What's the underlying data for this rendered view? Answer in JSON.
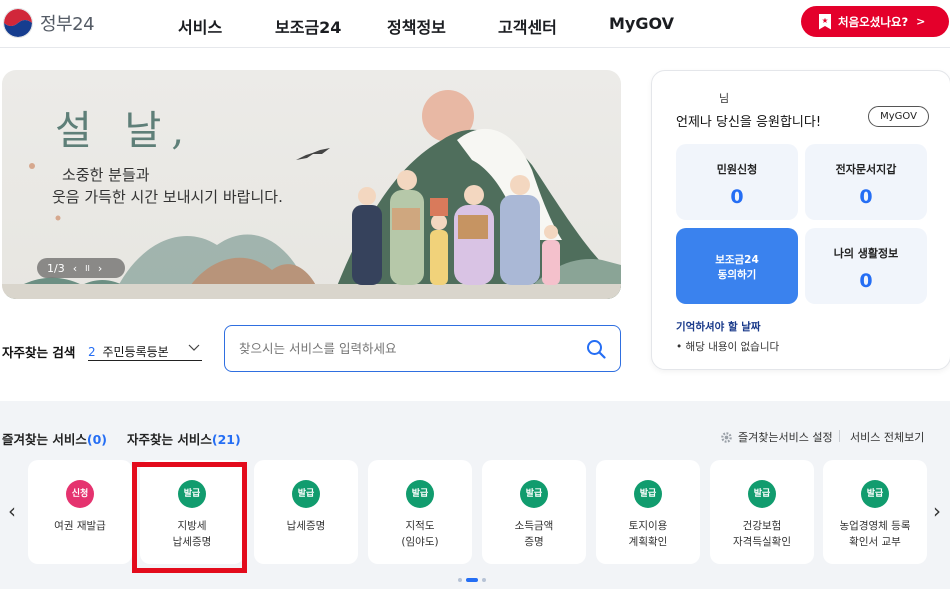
{
  "header": {
    "logo_text": "정부24",
    "nav": [
      "서비스",
      "보조금24",
      "정책정보",
      "고객센터",
      "MyGOV"
    ],
    "first_visit_label": "처음오셨나요?",
    "first_visit_chevron": ">"
  },
  "banner": {
    "title": "설 날,",
    "subtitle_line1": "소중한 분들과",
    "subtitle_line2": "웃음 가득한 시간 보내시기 바랍니다.",
    "pager": "1/3",
    "prev": "‹",
    "pause": "II",
    "next": "›"
  },
  "search": {
    "label": "자주찾는 검색",
    "select_num": "2",
    "select_value": "주민등록등본",
    "placeholder": "찾으시는 서비스를 입력하세요"
  },
  "panel": {
    "user": "님",
    "title": "언제나 당신을 응원합니다!",
    "mygov_button": "MyGOV",
    "tiles": [
      {
        "label": "민원신청",
        "value": "0"
      },
      {
        "label": "전자문서지갑",
        "value": "0"
      },
      {
        "label_line1": "보조금24",
        "label_line2": "동의하기"
      },
      {
        "label": "나의 생활정보",
        "value": "0"
      }
    ],
    "remember_title": "기억하셔야 할 날짜",
    "remember_empty": "해당 내용이 없습니다"
  },
  "services": {
    "fav_label": "즐겨찾는 서비스",
    "fav_count": "(0)",
    "freq_label": "자주찾는 서비스",
    "freq_count": "(21)",
    "fav_setting": "즐겨찾는서비스 설정",
    "view_all": "서비스 전체보기",
    "cards": [
      {
        "badge": "신청",
        "line1": "여권 재발급",
        "line2": ""
      },
      {
        "badge": "발급",
        "line1": "지방세",
        "line2": "납세증명"
      },
      {
        "badge": "발급",
        "line1": "납세증명",
        "line2": ""
      },
      {
        "badge": "발급",
        "line1": "지적도",
        "line2": "(임야도)"
      },
      {
        "badge": "발급",
        "line1": "소득금액",
        "line2": "증명"
      },
      {
        "badge": "발급",
        "line1": "토지이용",
        "line2": "계획확인"
      },
      {
        "badge": "발급",
        "line1": "건강보험",
        "line2": "자격득실확인"
      },
      {
        "badge": "발급",
        "line1": "농업경영체 등록",
        "line2": "확인서 교부"
      }
    ],
    "prev_arrow": "‹",
    "next_arrow": "›"
  },
  "colors": {
    "accent_blue": "#256ef4",
    "first_visit_red": "#e4002b",
    "highlight_red": "#e30b1c",
    "badge_green": "#119c6e",
    "badge_pink": "#e5336f"
  }
}
